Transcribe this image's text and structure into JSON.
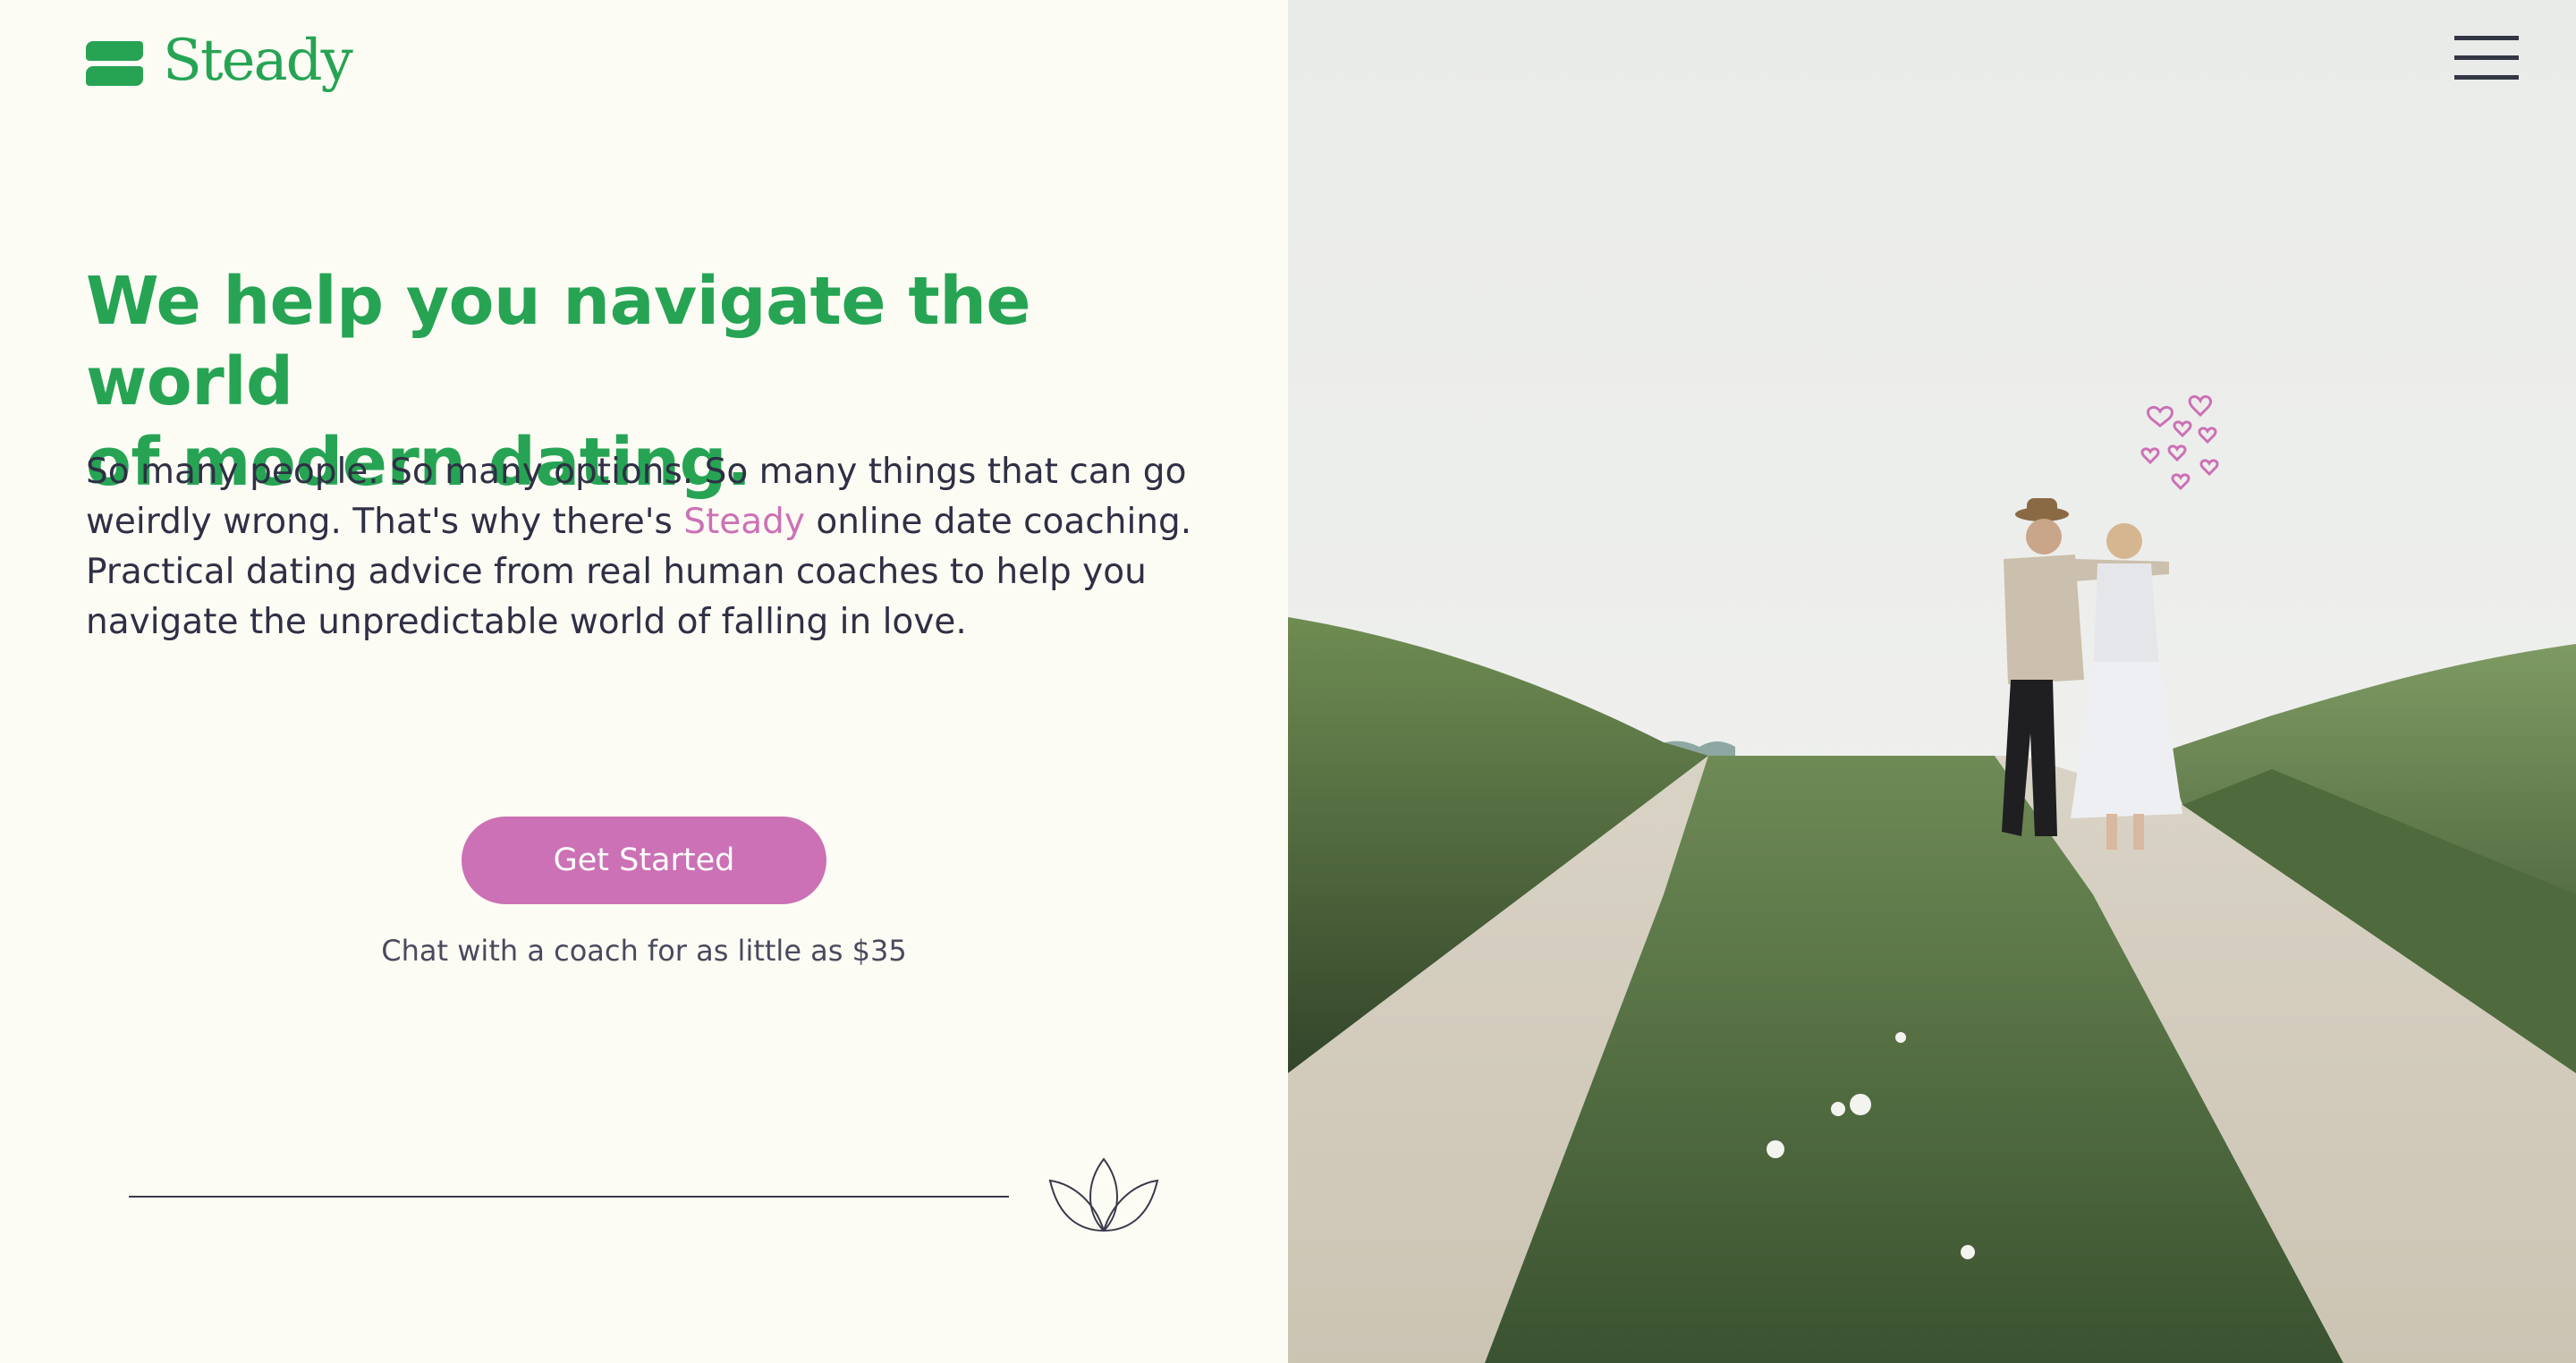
{
  "brand": {
    "name": "Steady",
    "colors": {
      "green": "#26a454",
      "pink": "#cc71b5",
      "background": "#fdfcf4",
      "text": "#2f2f45"
    }
  },
  "header": {
    "menu_icon": "hamburger-menu-icon"
  },
  "hero": {
    "headline_line1": "We help you navigate the world",
    "headline_line2": "of modern dating.",
    "body_before": "So many people. So many options. So many things that can go weirdly wrong. That's why there's ",
    "body_highlight": "Steady",
    "body_after": " online date coaching. Practical dating advice from real human coaches to help you navigate the unpredictable world of falling in love.",
    "cta_label": "Get Started",
    "cta_note": "Chat with a coach for as little as $35"
  },
  "decor": {
    "divider_icon": "lotus-icon"
  },
  "photo": {
    "subject": "couple-walking-on-path-photo",
    "overlay_icon": "hearts-doodle-icon"
  }
}
